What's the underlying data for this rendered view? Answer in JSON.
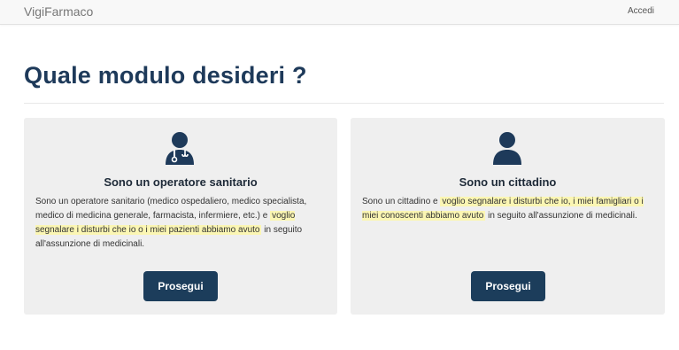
{
  "navbar": {
    "brand": "VigiFarmaco",
    "login_label": "Accedi"
  },
  "page": {
    "title": "Quale modulo desideri ?"
  },
  "cards": [
    {
      "icon": "doctor-icon",
      "title": "Sono un operatore sanitario",
      "text_before": "Sono un operatore sanitario (medico ospedaliero, medico specialista, medico di medicina generale, farmacista, infermiere, etc.) e",
      "text_highlight": "voglio segnalare i disturbi che io o i miei pazienti abbiamo avuto",
      "text_after": "in seguito all'assunzione di medicinali.",
      "button_label": "Prosegui"
    },
    {
      "icon": "user-icon",
      "title": "Sono un cittadino",
      "text_before": "Sono un cittadino e",
      "text_highlight": "voglio segnalare i disturbi che io, i miei famigliari o i miei conoscenti abbiamo avuto",
      "text_after": "in seguito all'assunzione di medicinali.",
      "button_label": "Prosegui"
    }
  ],
  "colors": {
    "title": "#1e3a5a",
    "button": "#1c3d5b",
    "card_bg": "#efefef",
    "highlight": "#fbf6b3"
  }
}
